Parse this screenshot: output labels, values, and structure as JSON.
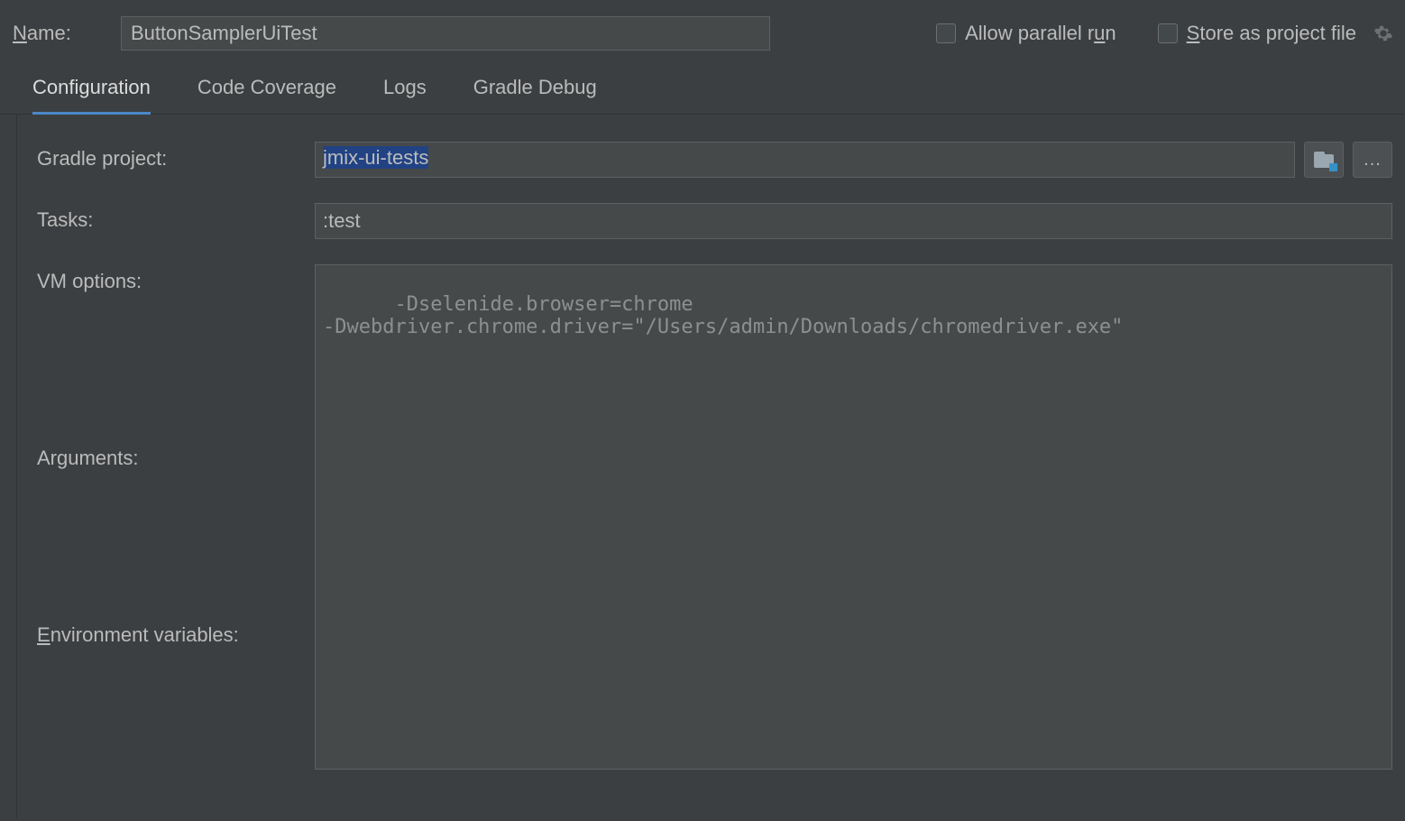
{
  "header": {
    "name_label_prefix": "N",
    "name_label_rest": "ame:",
    "name_value": "ButtonSamplerUiTest",
    "allow_parallel_prefix": "Allow parallel r",
    "allow_parallel_ul": "u",
    "allow_parallel_suffix": "n",
    "allow_parallel_checked": false,
    "store_prefix": "S",
    "store_rest": "tore as project file",
    "store_checked": false
  },
  "tabs": {
    "items": [
      {
        "label": "Configuration",
        "active": true
      },
      {
        "label": "Code Coverage",
        "active": false
      },
      {
        "label": "Logs",
        "active": false
      },
      {
        "label": "Gradle Debug",
        "active": false
      }
    ]
  },
  "form": {
    "gradle_project_label": "Gradle project:",
    "gradle_project_value": "jmix-ui-tests",
    "tasks_label": "Tasks:",
    "tasks_value": ":test",
    "vm_options_label": "VM options:",
    "vm_options_value": "-Dselenide.browser=chrome\n-Dwebdriver.chrome.driver=\"/Users/admin/Downloads/chromedriver.exe\"",
    "arguments_label": "Arguments:",
    "arguments_value": "",
    "env_label_prefix": "E",
    "env_label_rest": "nvironment variables:",
    "env_value": "",
    "browse_dots": "..."
  },
  "colors": {
    "background": "#3c3f41",
    "accent": "#4a88c7",
    "input_bg": "#45494a",
    "border": "#5e6060"
  }
}
